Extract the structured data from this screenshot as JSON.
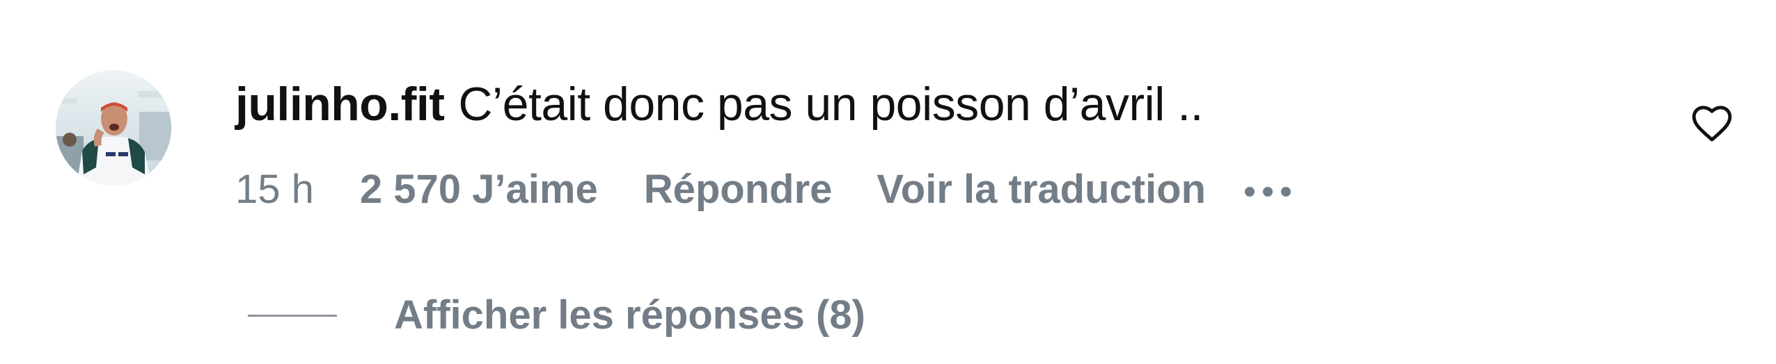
{
  "comment": {
    "username": "julinho.fit",
    "text": "C’était donc pas un poisson d’avril ..",
    "avatar_icon": "profile-photo"
  },
  "meta": {
    "timestamp": "15 h",
    "likes": "2 570 J’aime",
    "reply_label": "Répondre",
    "translate_label": "Voir la traduction",
    "more_icon": "more-horizontal-icon"
  },
  "replies": {
    "label": "Afficher les réponses (8)"
  },
  "like_button": {
    "icon": "heart-outline-icon"
  },
  "colors": {
    "primary_text": "#111111",
    "secondary_text": "#737d87",
    "background": "#ffffff"
  }
}
